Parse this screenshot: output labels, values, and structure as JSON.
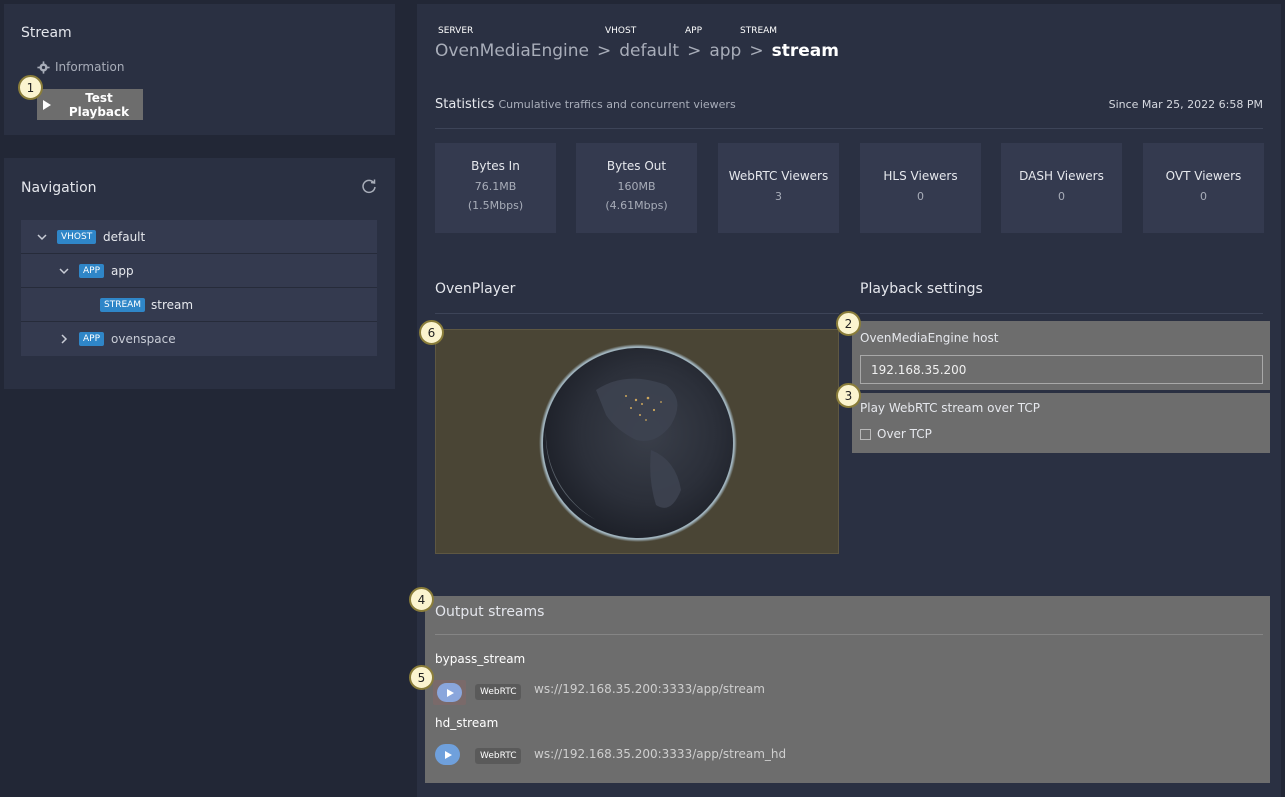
{
  "sidebar": {
    "stream_panel": {
      "title": "Stream",
      "information_label": "Information",
      "test_playback_label": "Test Playback"
    },
    "navigation": {
      "title": "Navigation",
      "tree": [
        {
          "badge": "VHOST",
          "label": "default",
          "expanded": true
        },
        {
          "badge": "APP",
          "label": "app",
          "expanded": true
        },
        {
          "badge": "STREAM",
          "label": "stream"
        },
        {
          "badge": "APP",
          "label": "ovenspace",
          "expanded": false
        }
      ]
    }
  },
  "breadcrumb": {
    "tags": [
      "SERVER",
      "VHOST",
      "APP",
      "STREAM"
    ],
    "items": [
      "OvenMediaEngine",
      "default",
      "app",
      "stream"
    ],
    "separator": ">"
  },
  "statistics": {
    "title": "Statistics",
    "subtitle": "Cumulative traffics and concurrent viewers",
    "since": "Since Mar 25, 2022 6:58 PM",
    "cards": [
      {
        "label": "Bytes In",
        "value": "76.1MB",
        "rate": "(1.5Mbps)"
      },
      {
        "label": "Bytes Out",
        "value": "160MB",
        "rate": "(4.61Mbps)"
      },
      {
        "label": "WebRTC Viewers",
        "value": "3"
      },
      {
        "label": "HLS Viewers",
        "value": "0"
      },
      {
        "label": "DASH Viewers",
        "value": "0"
      },
      {
        "label": "OVT Viewers",
        "value": "0"
      }
    ]
  },
  "player": {
    "title": "OvenPlayer"
  },
  "playback_settings": {
    "title": "Playback settings",
    "host_label": "OvenMediaEngine host",
    "host_value": "192.168.35.200",
    "tcp_label": "Play WebRTC stream over TCP",
    "tcp_checkbox_label": "Over TCP",
    "tcp_checked": false
  },
  "output_streams": {
    "title": "Output streams",
    "streams": [
      {
        "name": "bypass_stream",
        "protocol": "WebRTC",
        "url": "ws://192.168.35.200:3333/app/stream"
      },
      {
        "name": "hd_stream",
        "protocol": "WebRTC",
        "url": "ws://192.168.35.200:3333/app/stream_hd"
      }
    ]
  },
  "callouts": [
    "1",
    "2",
    "3",
    "4",
    "5",
    "6"
  ]
}
